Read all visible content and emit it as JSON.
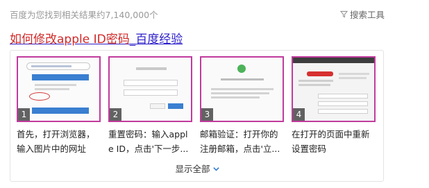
{
  "header": {
    "result_count": "百度为您找到相关结果约7,140,000个",
    "search_tools": "搜索工具",
    "search_tools_icon": "funnel-icon"
  },
  "result": {
    "title_highlight": "如何修改apple ID密码",
    "title_rest": "_百度经验",
    "title_color": "#2b1dc9",
    "highlight_color": "#d02828"
  },
  "steps": [
    {
      "number": "1",
      "caption": "首先，打开浏览器，输入图片中的网址"
    },
    {
      "number": "2",
      "caption": "重置密码：输入apple ID，点击'下一步..."
    },
    {
      "number": "3",
      "caption": "邮箱验证：打开你的注册邮箱，点击'立..."
    },
    {
      "number": "4",
      "caption": "在打开的页面中重新设置密码"
    }
  ],
  "footer": {
    "show_all": "显示全部",
    "show_all_icon": "chevron-down-icon"
  },
  "colors": {
    "thumb_border": "#c13b9e",
    "accent_blue": "#3a7fd1"
  }
}
